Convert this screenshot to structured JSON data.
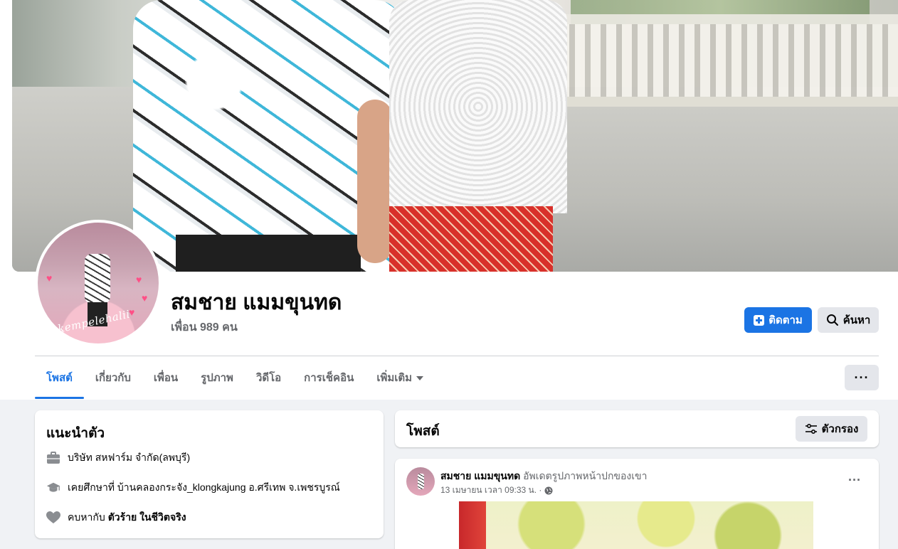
{
  "profile": {
    "name": "สมชาย แมมขุนทด",
    "friends": "เพื่อน 989 คน",
    "avatar_tag": "#kempelehalii"
  },
  "actions": {
    "follow_label": "ติดตาม",
    "search_label": "ค้นหา",
    "more_label": "···"
  },
  "tabs": [
    {
      "label": "โพสต์",
      "active": true
    },
    {
      "label": "เกี่ยวกับ",
      "active": false
    },
    {
      "label": "เพื่อน",
      "active": false
    },
    {
      "label": "รูปภาพ",
      "active": false
    },
    {
      "label": "วิดีโอ",
      "active": false
    },
    {
      "label": "การเช็คอิน",
      "active": false
    },
    {
      "label": "เพิ่มเติม",
      "active": false
    }
  ],
  "intro": {
    "title": "แนะนำตัว",
    "work": "บริษัท สหฟาร์ม จำกัด(ลพบุรี)",
    "education": "เคยศึกษาที่ บ้านคลองกระจัง_klongkajung อ.ศรีเทพ จ.เพชรบูรณ์",
    "relationship_prefix": "คบหากับ ",
    "relationship_name": "ตัวร้าย ในชีวิตจริง"
  },
  "posts": {
    "title": "โพสต์",
    "filter_label": "ตัวกรอง"
  },
  "post": {
    "author": "สมชาย แมมขุนทด",
    "action": "อัพเดตรูปภาพหน้าปกของเขา",
    "timestamp": "13 เมษายน เวลา 09:33 น. ·",
    "more_label": "···"
  },
  "colors": {
    "accent": "#1b74e4",
    "background": "#f0f2f5",
    "secondary_text": "#65676b",
    "button_gray": "#e4e6eb"
  }
}
